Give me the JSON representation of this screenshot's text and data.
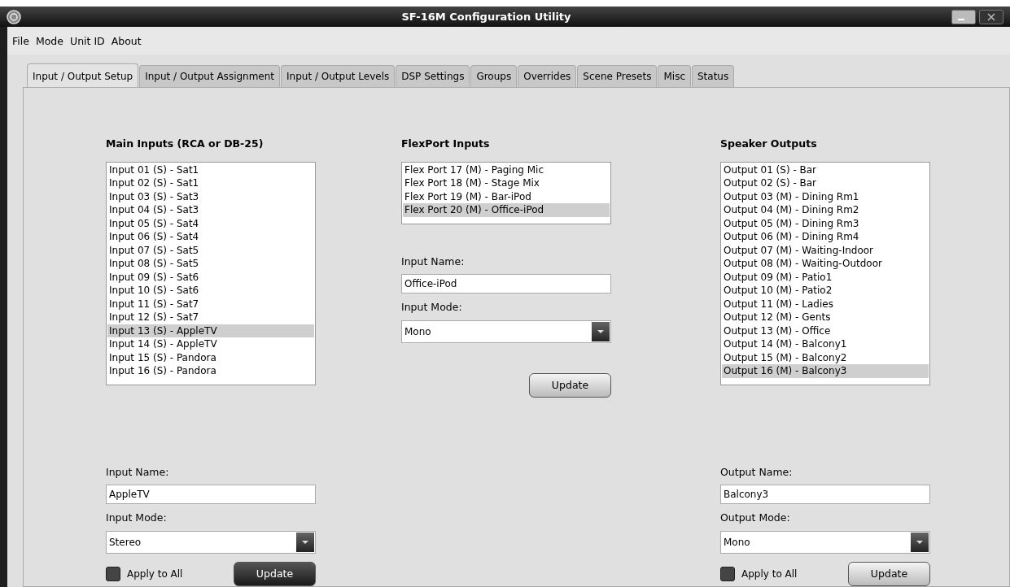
{
  "window": {
    "title": "SF-16M Configuration Utility"
  },
  "menu": [
    "File",
    "Mode",
    "Unit ID",
    "About"
  ],
  "tabs": [
    {
      "label": "Input / Output Setup",
      "selected": true
    },
    {
      "label": "Input / Output Assignment",
      "selected": false
    },
    {
      "label": "Input / Output Levels",
      "selected": false
    },
    {
      "label": "DSP Settings",
      "selected": false
    },
    {
      "label": "Groups",
      "selected": false
    },
    {
      "label": "Overrides",
      "selected": false
    },
    {
      "label": "Scene Presets",
      "selected": false
    },
    {
      "label": "Misc",
      "selected": false
    },
    {
      "label": "Status",
      "selected": false
    }
  ],
  "panels": [
    {
      "title": "Main Inputs (RCA or DB-25)",
      "items": [
        {
          "label": "Input 01 (S) - Sat1",
          "selected": false
        },
        {
          "label": "Input 02 (S) - Sat1",
          "selected": false
        },
        {
          "label": "Input 03 (S) - Sat3",
          "selected": false
        },
        {
          "label": "Input 04 (S) - Sat3",
          "selected": false
        },
        {
          "label": "Input 05 (S) - Sat4",
          "selected": false
        },
        {
          "label": "Input 06 (S) - Sat4",
          "selected": false
        },
        {
          "label": "Input 07 (S) - Sat5",
          "selected": false
        },
        {
          "label": "Input 08 (S) - Sat5",
          "selected": false
        },
        {
          "label": "Input 09 (S) - Sat6",
          "selected": false
        },
        {
          "label": "Input 10 (S) - Sat6",
          "selected": false
        },
        {
          "label": "Input 11 (S) - Sat7",
          "selected": false
        },
        {
          "label": "Input 12 (S) - Sat7",
          "selected": false
        },
        {
          "label": "Input 13 (S) - AppleTV",
          "selected": true
        },
        {
          "label": "Input 14 (S) - AppleTV",
          "selected": false
        },
        {
          "label": "Input 15 (S) - Pandora",
          "selected": false
        },
        {
          "label": "Input 16 (S) - Pandora",
          "selected": false
        }
      ],
      "name_label": "Input Name:",
      "name_value": "AppleTV",
      "mode_label": "Input Mode:",
      "mode_value": "Stereo",
      "apply_all": {
        "label": "Apply to All",
        "checked": false
      },
      "button": {
        "label": "Update",
        "focused": true
      }
    },
    {
      "title": "FlexPort Inputs",
      "items": [
        {
          "label": "Flex Port 17 (M) - Paging Mic",
          "selected": false
        },
        {
          "label": "Flex Port 18 (M) - Stage Mix",
          "selected": false
        },
        {
          "label": "Flex Port 19 (M) - Bar-iPod",
          "selected": false
        },
        {
          "label": "Flex Port 20 (M) - Office-iPod",
          "selected": true
        }
      ],
      "name_label": "Input Name:",
      "name_value": "Office-iPod",
      "mode_label": "Input Mode:",
      "mode_value": "Mono",
      "button": {
        "label": "Update",
        "focused": false
      }
    },
    {
      "title": "Speaker Outputs",
      "items": [
        {
          "label": "Output 01 (S) - Bar",
          "selected": false
        },
        {
          "label": "Output 02 (S) - Bar",
          "selected": false
        },
        {
          "label": "Output 03 (M) - Dining Rm1",
          "selected": false
        },
        {
          "label": "Output 04 (M) - Dining Rm2",
          "selected": false
        },
        {
          "label": "Output 05 (M) - Dining Rm3",
          "selected": false
        },
        {
          "label": "Output 06 (M) - Dining Rm4",
          "selected": false
        },
        {
          "label": "Output 07 (M) - Waiting-Indoor",
          "selected": false
        },
        {
          "label": "Output 08 (M) - Waiting-Outdoor",
          "selected": false
        },
        {
          "label": "Output 09 (M) - Patio1",
          "selected": false
        },
        {
          "label": "Output 10 (M) - Patio2",
          "selected": false
        },
        {
          "label": "Output 11 (M) - Ladies",
          "selected": false
        },
        {
          "label": "Output 12 (M) - Gents",
          "selected": false
        },
        {
          "label": "Output 13 (M) - Office",
          "selected": false
        },
        {
          "label": "Output 14 (M) - Balcony1",
          "selected": false
        },
        {
          "label": "Output 15 (M) - Balcony2",
          "selected": false
        },
        {
          "label": "Output 16 (M) - Balcony3",
          "selected": true
        }
      ],
      "name_label": "Output Name:",
      "name_value": "Balcony3",
      "mode_label": "Output Mode:",
      "mode_value": "Mono",
      "apply_all": {
        "label": "Apply to All",
        "checked": false
      },
      "button": {
        "label": "Update",
        "focused": false
      }
    }
  ]
}
